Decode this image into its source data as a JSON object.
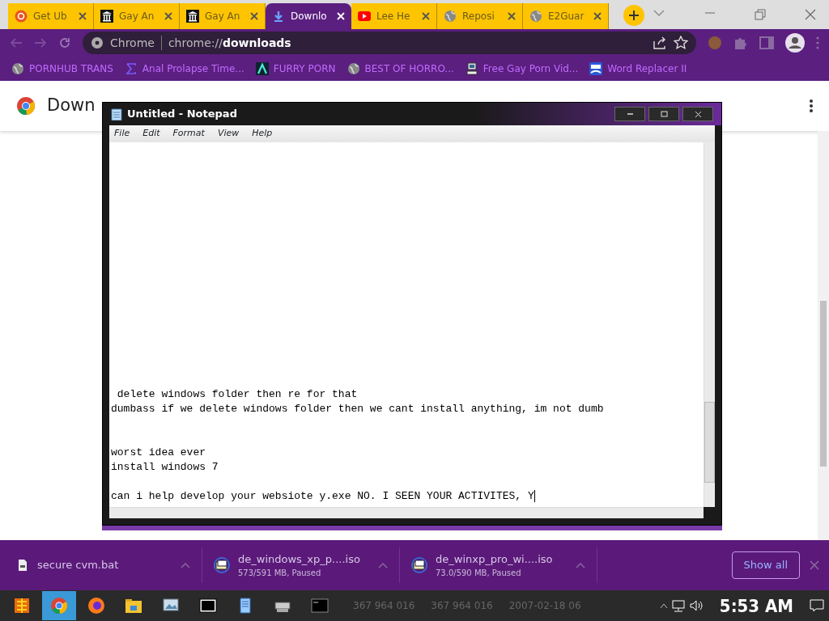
{
  "tabs": [
    {
      "title": "Get Ub",
      "kind": "ubuntu",
      "selected": false
    },
    {
      "title": "Gay An",
      "kind": "museum",
      "selected": false
    },
    {
      "title": "Gay An",
      "kind": "museum",
      "selected": false
    },
    {
      "title": "Downlo",
      "kind": "download",
      "selected": true
    },
    {
      "title": "Lee He",
      "kind": "youtube",
      "selected": false
    },
    {
      "title": "Reposi",
      "kind": "globe",
      "selected": false
    },
    {
      "title": "E2Guar",
      "kind": "globe",
      "selected": false
    }
  ],
  "address_bar": {
    "site": "Chrome",
    "url": "chrome://**downloads**"
  },
  "bookmarks": [
    {
      "title": "PORNHUB TRANS",
      "kind": "globe"
    },
    {
      "title": "Anal Prolapse Time...",
      "kind": "sigma"
    },
    {
      "title": "FURRY PORN",
      "kind": "lambda"
    },
    {
      "title": "BEST OF HORRO...",
      "kind": "globe"
    },
    {
      "title": "Free Gay Porn Vid...",
      "kind": "computer"
    },
    {
      "title": "Word Replacer II",
      "kind": "wr"
    }
  ],
  "page": {
    "title": "Down"
  },
  "notepad": {
    "title": "Untitled - Notepad",
    "menu": [
      "File",
      "Edit",
      "Format",
      "View",
      "Help"
    ],
    "lines": [
      {
        "kind": "text",
        "text": " delete windows folder then re for that"
      },
      {
        "kind": "text",
        "text": "dumbass if we delete windows folder then we cant install anything, im not dumb"
      },
      {
        "kind": "blank"
      },
      {
        "kind": "blank"
      },
      {
        "kind": "text",
        "text": "worst idea ever"
      },
      {
        "kind": "text",
        "text": "install windows 7"
      },
      {
        "kind": "blank"
      },
      {
        "kind": "text",
        "text": "can i help develop your websiote y.exe NO. I SEEN YOUR ACTIVITES, Y",
        "cursor": true
      }
    ]
  },
  "downloads": [
    {
      "name": "secure cvm.bat",
      "kind": "file"
    },
    {
      "name": "de_windows_xp_p....iso",
      "status": "573/591 MB, Paused",
      "kind": "iso"
    },
    {
      "name": "de_winxp_pro_wi....iso",
      "status": "73.0/590 MB, Paused",
      "kind": "iso"
    }
  ],
  "show_all": "Show all",
  "taskbar": {
    "ghost_texts": [
      "367 964 016",
      "367 964 016",
      "2007-02-18 06"
    ],
    "clock": "5:53 AM"
  }
}
